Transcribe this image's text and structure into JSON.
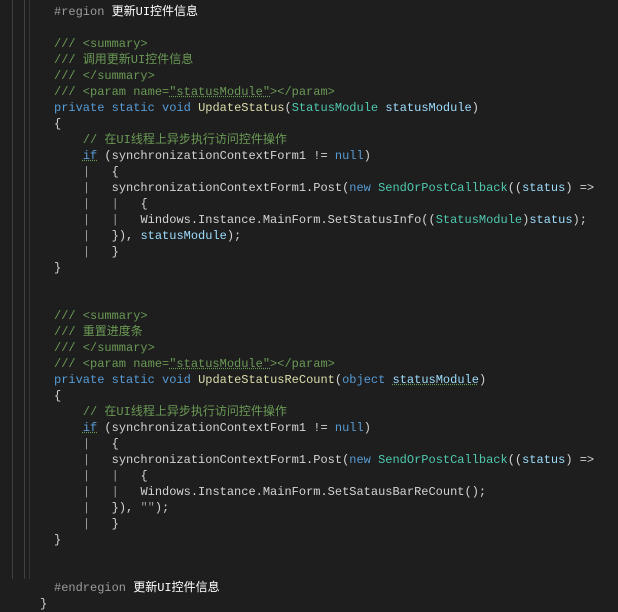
{
  "region": {
    "start": "#region",
    "end": "#endregion",
    "title": "更新UI控件信息"
  },
  "method1": {
    "doc_summary_open": "/// <summary>",
    "doc_desc": "/// 调用更新UI控件信息",
    "doc_summary_close": "/// </summary>",
    "doc_param_open": "/// <param name=",
    "doc_param_name": "\"statusModule\"",
    "doc_param_close": "></param>",
    "kw_private": "private",
    "kw_static": "static",
    "kw_void": "void",
    "name": "UpdateStatus",
    "param_type": "StatusModule",
    "param_name": "statusModule",
    "comment_cn": "// 在UI线程上异步执行访问控件操作",
    "kw_if": "if",
    "cond_var": "synchronizationContextForm1",
    "cond_op": " != ",
    "cond_null": "null",
    "post_call": "synchronizationContextForm1.Post(",
    "kw_new": "new",
    "delegate_type": "SendOrPostCallback",
    "lambda_param": "status",
    "lambda_arrow": ") =>",
    "inner_call_pre": "Windows.Instance.MainForm.SetStatusInfo((",
    "inner_cast": "StatusModule",
    "inner_call_mid": ")",
    "inner_var": "status",
    "inner_end": ");",
    "post_close": "}), ",
    "post_arg": "statusModule",
    "post_end": ");"
  },
  "method2": {
    "doc_summary_open": "/// <summary>",
    "doc_desc": "/// 重置进度条",
    "doc_summary_close": "/// </summary>",
    "doc_param_open": "/// <param name=",
    "doc_param_name": "\"statusModule\"",
    "doc_param_close": "></param>",
    "kw_private": "private",
    "kw_static": "static",
    "kw_void": "void",
    "name": "UpdateStatusReCount",
    "param_type": "object",
    "param_name": "statusModule",
    "comment_cn": "// 在UI线程上异步执行访问控件操作",
    "kw_if": "if",
    "cond_var": "synchronizationContextForm1",
    "cond_op": " != ",
    "cond_null": "null",
    "post_call": "synchronizationContextForm1.Post(",
    "kw_new": "new",
    "delegate_type": "SendOrPostCallback",
    "lambda_param": "status",
    "lambda_arrow": ") =>",
    "inner_call": "Windows.Instance.MainForm.SetSatausBarReCount();",
    "post_close": "}), ",
    "post_arg": "\"\"",
    "post_end": ");"
  },
  "brace_open": "{",
  "brace_close": "}",
  "pipe": "|"
}
